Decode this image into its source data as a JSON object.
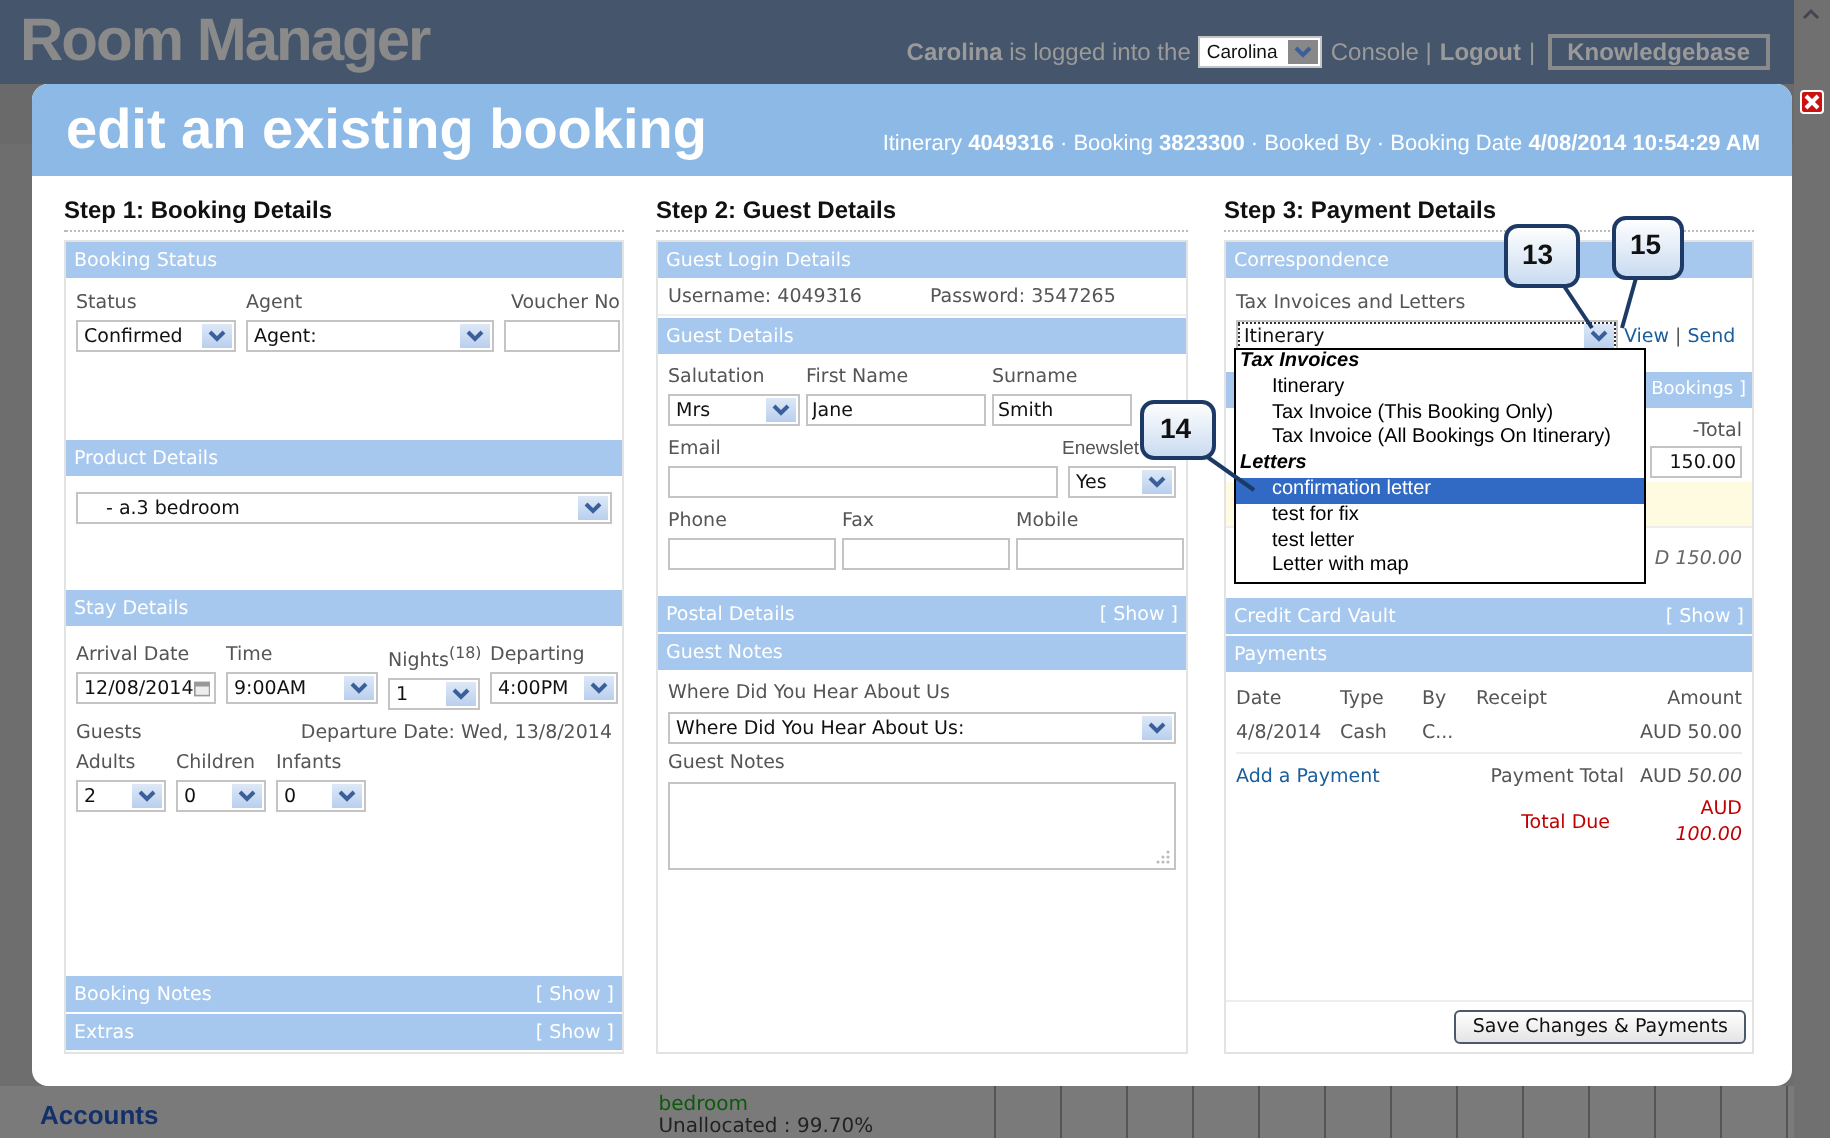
{
  "app": {
    "title": "Room Manager",
    "user": "Carolina",
    "login_text": "is logged into the",
    "console_select": "Carolina",
    "console_text": "Console |",
    "logout": "Logout",
    "separator": "|",
    "knowledgebase": "Knowledgebase"
  },
  "background": {
    "section": "Accounts",
    "room": "bedroom",
    "occupancy": "Unallocated : 99.70%"
  },
  "modal": {
    "title": "edit an existing booking",
    "meta": "Itinerary **4049316** · Booking **3823300** · Booked By · Booking Date **4/08/2014 10:54:29 AM**"
  },
  "booking": {
    "heading": "Step 1: Booking Details",
    "status_section": {
      "title": "Booking Status",
      "status": {
        "label": "Status",
        "value": "Confirmed"
      },
      "agent": {
        "label": "Agent",
        "value": "Agent:"
      },
      "voucher": {
        "label": "Voucher No"
      }
    },
    "product_section": {
      "title": "Product Details",
      "product": "- a.3 bedroom"
    },
    "stay_section": {
      "title": "Stay Details",
      "arrival": {
        "label": "Arrival Date",
        "value": "12/08/2014"
      },
      "time": {
        "label": "Time",
        "value": "9:00AM"
      },
      "nights": {
        "label": "Nights$^{(18)}$",
        "value": "1"
      },
      "departing": {
        "label": "Departing",
        "value": "4:00PM"
      },
      "guests_label": "Guests",
      "departure_date": "Departure Date: Wed, 13/8/2014",
      "adults": {
        "label": "Adults",
        "value": "2"
      },
      "children": {
        "label": "Children",
        "value": "0"
      },
      "infants": {
        "label": "Infants",
        "value": "0"
      }
    },
    "collapsed": [
      {
        "title": "Booking Notes",
        "toggle": "[ Show ]"
      },
      {
        "title": "Extras",
        "toggle": "[ Show ]"
      }
    ]
  },
  "guest": {
    "heading": "Step 2: Guest Details",
    "login_section": {
      "title": "Guest Login Details",
      "username": "Username: 4049316",
      "password": "Password: 3547265"
    },
    "details_section": {
      "title": "Guest Details",
      "salutation": {
        "label": "Salutation",
        "value": "Mrs"
      },
      "first_name": {
        "label": "First Name",
        "value": "Jane"
      },
      "surname": {
        "label": "Surname",
        "value": "Smith"
      },
      "email": {
        "label": "Email"
      },
      "enewsletter": {
        "label": "Enewslet",
        "value": "Yes"
      },
      "phone": {
        "label": "Phone"
      },
      "fax": {
        "label": "Fax"
      },
      "mobile": {
        "label": "Mobile"
      }
    },
    "postal_section": {
      "title": "Postal Details",
      "toggle": "[ Show ]"
    },
    "notes_section": {
      "title": "Guest Notes",
      "hear_label": "Where Did You Hear About Us",
      "hear_value": "Where Did You Hear About Us:",
      "notes_label": "Guest Notes"
    }
  },
  "payment": {
    "heading": "Step 3: Payment Details",
    "correspondence": {
      "title": "Correspondence",
      "label": "Tax Invoices and Letters",
      "value": "Itinerary",
      "view": "View",
      "separator": "|",
      "send": "Send",
      "menu": [
        {
          "group": "Tax Invoices",
          "items": [
            {
              "label": "Itinerary",
              "selected": false
            },
            {
              "label": "Tax Invoice (This Booking Only)",
              "selected": false
            },
            {
              "label": "Tax Invoice (All Bookings On Itinerary)",
              "selected": false
            }
          ]
        },
        {
          "group": "Letters",
          "items": [
            {
              "label": "confirmation letter",
              "selected": true
            },
            {
              "label": "test for fix",
              "selected": false
            },
            {
              "label": "test letter",
              "selected": false
            },
            {
              "label": "Letter with map",
              "selected": false
            }
          ]
        }
      ]
    },
    "covered": {
      "header_fragment": "Bookings ]",
      "total_fragment": "-Total",
      "amount": "150.00",
      "sum_fragment": "D 150.00"
    },
    "vault": {
      "title": "Credit Card Vault",
      "toggle": "[ Show ]"
    },
    "payments": {
      "title": "Payments",
      "columns": [
        "Date",
        "Type",
        "By",
        "Receipt",
        "Amount"
      ],
      "rows": [
        {
          "date": "4/8/2014",
          "type": "Cash",
          "by": "C...",
          "amount": "AUD 50.00"
        }
      ],
      "add_link": "Add a Payment",
      "total_label": "Payment Total",
      "total_value": "AUD *50.00*",
      "due_label": "Total Due",
      "due_value": "AUD *100.00*"
    },
    "save_button": "Save Changes & Payments"
  },
  "callouts": [
    {
      "label": "13"
    },
    {
      "label": "14"
    },
    {
      "label": "15"
    }
  ]
}
